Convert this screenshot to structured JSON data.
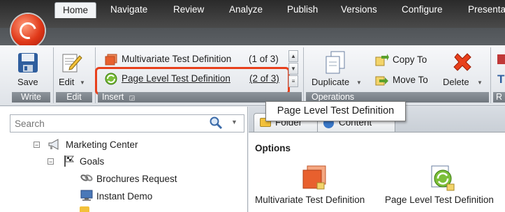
{
  "tabs": [
    "Home",
    "Navigate",
    "Review",
    "Analyze",
    "Publish",
    "Versions",
    "Configure",
    "Presenta"
  ],
  "ribbon": {
    "save": {
      "label": "Save",
      "group": "Write"
    },
    "edit": {
      "label": "Edit",
      "group": "Edit"
    },
    "insert": {
      "items": [
        {
          "label": "Multivariate Test Definition",
          "count": "(1 of 3)"
        },
        {
          "label": "Page Level Test Definition",
          "count": "(2 of 3)"
        }
      ],
      "group": "Insert"
    },
    "operations": {
      "duplicate": "Duplicate",
      "copy_to": "Copy To",
      "move_to": "Move To",
      "delete": "Delete",
      "group": "Operations"
    },
    "cut_group": "R"
  },
  "tooltip": "Page Level Test Definition",
  "search": {
    "placeholder": "Search"
  },
  "tree": [
    {
      "label": "Marketing Center",
      "icon": "megaphone-icon"
    },
    {
      "label": "Goals",
      "icon": "flag-icon"
    },
    {
      "label": "Brochures Request",
      "icon": "link-icon"
    },
    {
      "label": "Instant Demo",
      "icon": "monitor-icon"
    }
  ],
  "content_tabs": [
    "Folder",
    "Content"
  ],
  "options": {
    "title": "Options",
    "items": [
      "Multivariate Test Definition",
      "Page Level Test Definition"
    ]
  },
  "colors": {
    "accent": "#e8401c",
    "tab_bar": "#505458"
  }
}
